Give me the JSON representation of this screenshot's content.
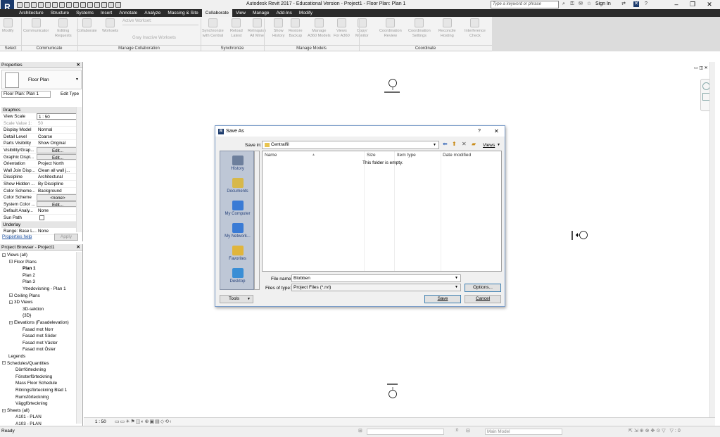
{
  "app": {
    "logo": "R",
    "title": "Autodesk Revit 2017 - Educational Version -     Project1 - Floor Plan: Plan 1",
    "search_placeholder": "Type a keyword or phrase",
    "sign_in": "Sign In",
    "window_controls": [
      "–",
      "❐",
      "✕"
    ]
  },
  "ribbon": {
    "tabs": [
      "Architecture",
      "Structure",
      "Systems",
      "Insert",
      "Annotate",
      "Analyze",
      "Massing & Site",
      "Collaborate",
      "View",
      "Manage",
      "Add-Ins",
      "Modify"
    ],
    "active_tab": "Collaborate",
    "buttons": [
      {
        "label": "Modify"
      },
      {
        "label": "Communicator"
      },
      {
        "label": "Editing\nRequests"
      },
      {
        "label": "Collaborate"
      },
      {
        "label": "Worksets"
      },
      {
        "label": "Synchronize\nwith Central"
      },
      {
        "label": "Reload\nLatest"
      },
      {
        "label": "Relinquish\nAll Mine"
      },
      {
        "label": "Show\nHistory"
      },
      {
        "label": "Restore\nBackup"
      },
      {
        "label": "Manage\nA360 Models"
      },
      {
        "label": "Views\nFor A360"
      },
      {
        "label": "Copy/\nMonitor"
      },
      {
        "label": "Coordination\nReview"
      },
      {
        "label": "Coordination\nSettings"
      },
      {
        "label": "Reconcile\nHosting"
      },
      {
        "label": "Interference\nCheck"
      }
    ],
    "active_workset_label": "Active Workset:",
    "gray_inactive_label": "Gray Inactive Worksets",
    "panels": [
      "Select",
      "Communicate",
      "Manage Collaboration",
      "Synchronize",
      "Manage Models",
      "Coordinate"
    ]
  },
  "properties": {
    "title": "Properties",
    "type": "Floor Plan",
    "selector": "Floor Plan: Plan 1",
    "edit_type": "Edit Type",
    "group_graphics": "Graphics",
    "rows": [
      {
        "k": "View Scale",
        "v": "1 : 50"
      },
      {
        "k": "Scale Value    1:",
        "v": "50"
      },
      {
        "k": "Display Model",
        "v": "Normal"
      },
      {
        "k": "Detail Level",
        "v": "Coarse"
      },
      {
        "k": "Parts Visibility",
        "v": "Show Original"
      },
      {
        "k": "Visibility/Grap...",
        "v": "Edit..."
      },
      {
        "k": "Graphic Displ...",
        "v": "Edit..."
      },
      {
        "k": "Orientation",
        "v": "Project North"
      },
      {
        "k": "Wall Join Disp...",
        "v": "Clean all wall j..."
      },
      {
        "k": "Discipline",
        "v": "Architectural"
      },
      {
        "k": "Show Hidden ...",
        "v": "By Discipline"
      },
      {
        "k": "Color Scheme...",
        "v": "Background"
      },
      {
        "k": "Color Scheme",
        "v": "<none>"
      },
      {
        "k": "System Color ...",
        "v": "Edit..."
      },
      {
        "k": "Default Analy...",
        "v": "None"
      },
      {
        "k": "Sun Path",
        "v": ""
      }
    ],
    "group_underlay": "Underlay",
    "underlay_row": {
      "k": "Range: Base L...",
      "v": "None"
    },
    "help": "Properties help",
    "apply": "Apply"
  },
  "browser": {
    "title": "Project Browser - Project1",
    "items": [
      {
        "t": "Views (all)",
        "indent": 0,
        "exp": "−",
        "bold": false
      },
      {
        "t": "Floor Plans",
        "indent": 1,
        "exp": "−",
        "bold": false
      },
      {
        "t": "Plan 1",
        "indent": 2,
        "exp": "",
        "bold": true
      },
      {
        "t": "Plan 2",
        "indent": 2,
        "exp": "",
        "bold": false
      },
      {
        "t": "Plan 3",
        "indent": 2,
        "exp": "",
        "bold": false
      },
      {
        "t": "Ytredovisning - Plan 1",
        "indent": 2,
        "exp": "",
        "bold": false
      },
      {
        "t": "Ceiling Plans",
        "indent": 1,
        "exp": "+",
        "bold": false
      },
      {
        "t": "3D Views",
        "indent": 1,
        "exp": "−",
        "bold": false
      },
      {
        "t": "3D-sektion",
        "indent": 2,
        "exp": "",
        "bold": false
      },
      {
        "t": "{3D}",
        "indent": 2,
        "exp": "",
        "bold": false
      },
      {
        "t": "Elevations (Fasadelevation)",
        "indent": 1,
        "exp": "−",
        "bold": false
      },
      {
        "t": "Fasad mot Norr",
        "indent": 2,
        "exp": "",
        "bold": false
      },
      {
        "t": "Fasad mot Söder",
        "indent": 2,
        "exp": "",
        "bold": false
      },
      {
        "t": "Fasad mot Väster",
        "indent": 2,
        "exp": "",
        "bold": false
      },
      {
        "t": "Fasad mot Öster",
        "indent": 2,
        "exp": "",
        "bold": false
      },
      {
        "t": "Legends",
        "indent": 0,
        "exp": "",
        "bold": false
      },
      {
        "t": "Schedules/Quantities",
        "indent": 0,
        "exp": "−",
        "bold": false
      },
      {
        "t": "Dörrförteckning",
        "indent": 1,
        "exp": "",
        "bold": false
      },
      {
        "t": "Fönsterförteckning",
        "indent": 1,
        "exp": "",
        "bold": false
      },
      {
        "t": "Mass Floor Schedule",
        "indent": 1,
        "exp": "",
        "bold": false
      },
      {
        "t": "Ritningsförteckning Blad 1",
        "indent": 1,
        "exp": "",
        "bold": false
      },
      {
        "t": "Rumsförteckning",
        "indent": 1,
        "exp": "",
        "bold": false
      },
      {
        "t": "Väggförteckning",
        "indent": 1,
        "exp": "",
        "bold": false
      },
      {
        "t": "Sheets (all)",
        "indent": 0,
        "exp": "−",
        "bold": false
      },
      {
        "t": "A101 - PLAN",
        "indent": 1,
        "exp": "",
        "bold": false
      },
      {
        "t": "A103 - PLAN",
        "indent": 1,
        "exp": "",
        "bold": false
      }
    ]
  },
  "dialog": {
    "title": "Save As",
    "help": "?",
    "close": "✕",
    "save_in_label": "Save in:",
    "save_in_value": "Centralfil",
    "views_label": "Views",
    "places": [
      "History",
      "Documents",
      "My Computer",
      "My Network...",
      "Favorites",
      "Desktop"
    ],
    "columns": [
      "Name",
      "Size",
      "Item type",
      "Date modified"
    ],
    "empty_text": "This folder is empty.",
    "file_name_label": "File name:",
    "file_name_value": "Blobben",
    "file_type_label": "Files of type:",
    "file_type_value": "Project Files  (*.rvt)",
    "options_button": "Options...",
    "tools_button": "Tools",
    "save_button": "Save",
    "cancel_button": "Cancel"
  },
  "view_control": {
    "scale": "1 : 50"
  },
  "status": {
    "left": "Ready",
    "model": "Main Model",
    "zero": ":0"
  }
}
